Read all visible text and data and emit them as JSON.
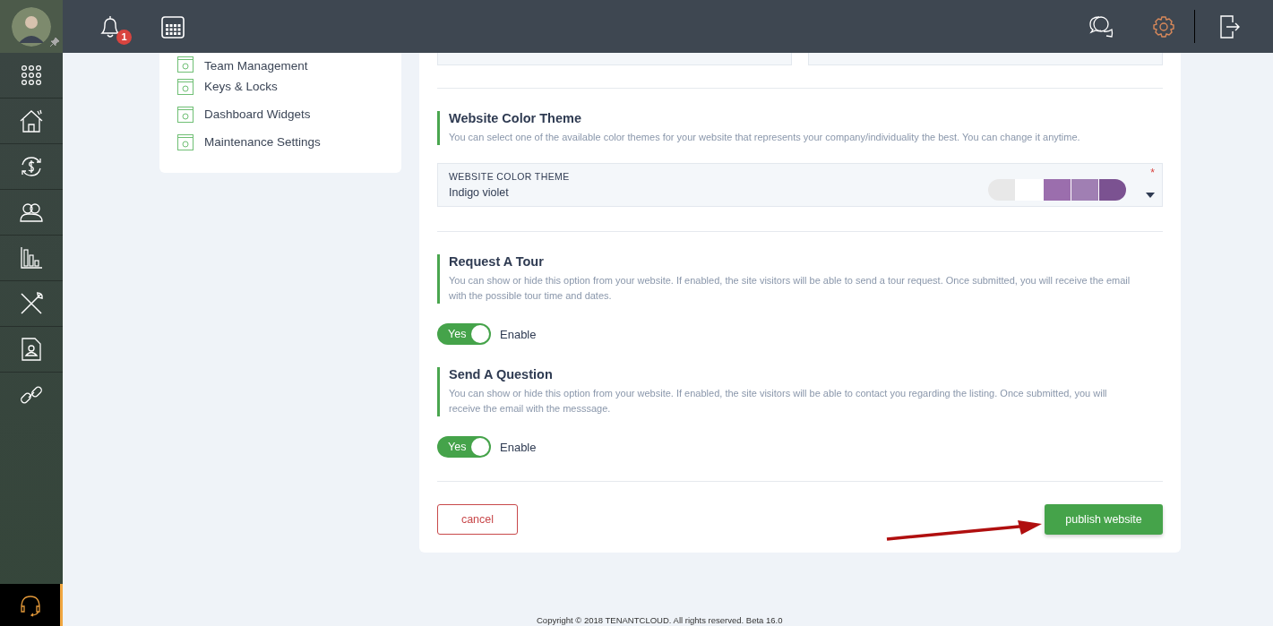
{
  "topbar": {
    "notification_count": "1"
  },
  "settings_menu": {
    "items": [
      {
        "label": "Team Management"
      },
      {
        "label": "Keys & Locks"
      },
      {
        "label": "Dashboard Widgets"
      },
      {
        "label": "Maintenance Settings"
      }
    ]
  },
  "theme_section": {
    "title": "Website Color Theme",
    "description": "You can select one of the available color themes for your website that represents your company/individuality the best. You can change it anytime.",
    "field": {
      "label": "WEBSITE COLOR THEME",
      "value": "Indigo violet",
      "required_mark": "*",
      "swatches": [
        {
          "color": "#e8e8e8"
        },
        {
          "color": "#ffffff"
        },
        {
          "color": "#9b6ead"
        },
        {
          "color": "#a07fb3"
        },
        {
          "color": "#7b5291"
        }
      ]
    }
  },
  "options": [
    {
      "title": "Request A Tour",
      "description": "You can show or hide this option from your website. If enabled, the site visitors will be able to send a tour request. Once submitted, you will receive the email with the possible tour time and dates.",
      "toggle": {
        "on": true,
        "text": "Yes"
      },
      "label": "Enable"
    },
    {
      "title": "Send A Question",
      "description": "You can show or hide this option from your website. If enabled, the site visitors will be able to contact you regarding the listing. Once submitted, you will receive the email with the messsage.",
      "toggle": {
        "on": true,
        "text": "Yes"
      },
      "label": "Enable"
    }
  ],
  "buttons": {
    "cancel": "cancel",
    "publish": "publish website"
  },
  "footer": {
    "copyright": "Copyright © 2018 TENANTCLOUD. All rights reserved. Beta 16.0"
  }
}
